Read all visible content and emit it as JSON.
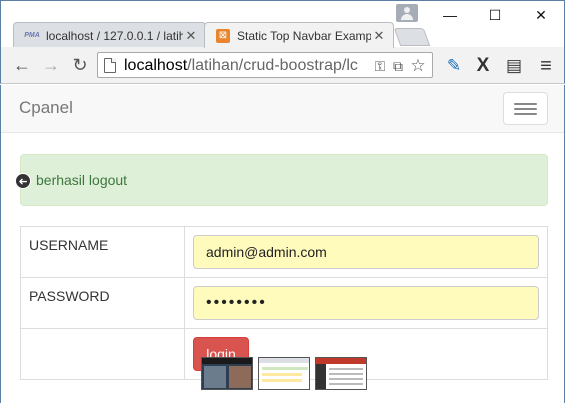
{
  "window": {
    "minimize_glyph": "—",
    "maximize_glyph": "☐",
    "close_glyph": "✕",
    "profile_icon": "person-icon"
  },
  "tabs": [
    {
      "title": "localhost / 127.0.0.1 / latih",
      "favicon": "phpmyadmin-icon",
      "favicon_text": "PMA",
      "close": "✕",
      "active": false
    },
    {
      "title": "Static Top Navbar Exampl",
      "favicon": "bootstrap-icon",
      "favicon_text": "⊠",
      "close": "✕",
      "active": true
    }
  ],
  "toolbar": {
    "back_glyph": "←",
    "forward_glyph": "→",
    "reload_glyph": "↻",
    "url_host": "localhost",
    "url_path": "/latihan/crud-boostrap/lc",
    "key_glyph": "⚿",
    "translate_glyph": "⧉",
    "star_glyph": "☆",
    "dropper_glyph": "✎",
    "x_ext_glyph": "X",
    "film_glyph": "▤",
    "menu_glyph": "≡"
  },
  "page": {
    "brand": "Cpanel",
    "alert_text": "berhasil logout",
    "back_glyph": "➜",
    "username_label": "USERNAME",
    "username_value": "admin@admin.com",
    "password_label": "PASSWORD",
    "password_value": "••••••••",
    "login_label": "login"
  },
  "colors": {
    "alert_bg": "#dff0d8",
    "alert_text": "#3c763d",
    "autofill_bg": "#fffbbd",
    "login_button": "#d9534f"
  }
}
